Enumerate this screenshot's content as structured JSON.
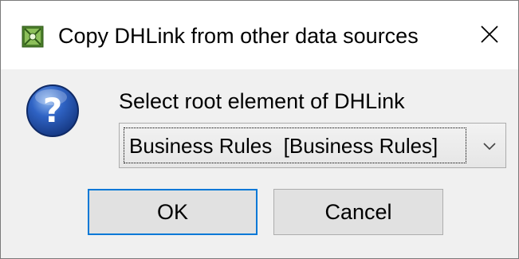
{
  "dialog": {
    "title": "Copy DHLink from other data sources",
    "title_icon": "dhlink-app-icon",
    "close_icon": "close-icon",
    "message_icon": "question-icon",
    "prompt": "Select root element of DHLink",
    "root_select": {
      "selected_value": "Business Rules  [Business Rules]"
    },
    "buttons": {
      "ok_label": "OK",
      "cancel_label": "Cancel"
    }
  },
  "colors": {
    "focus_border": "#0078d7",
    "title_bar": "#ffffff",
    "client_area": "#f0f0f0",
    "button_face": "#e1e1e1"
  }
}
